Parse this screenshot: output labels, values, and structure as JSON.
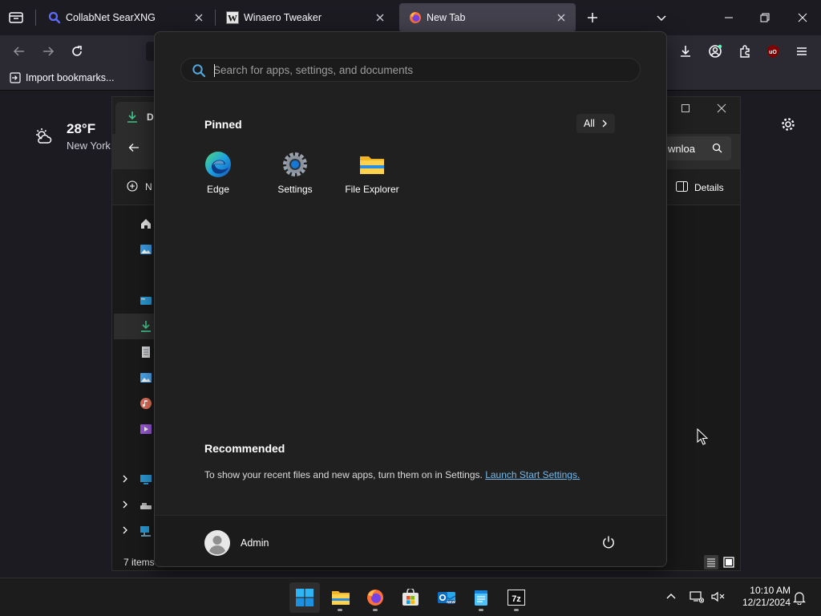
{
  "browser": {
    "tabs": [
      {
        "title": "CollabNet SearXNG"
      },
      {
        "title": "Winaero Tweaker"
      },
      {
        "title": "New Tab"
      }
    ],
    "bookmarks": {
      "import_label": "Import bookmarks..."
    },
    "weather": {
      "temp": "28°F",
      "location": "New York"
    }
  },
  "explorer": {
    "tab_title_partial": "D",
    "search_partial": "wnloa",
    "new_partial": "N",
    "details_label": "Details",
    "status": "7 items"
  },
  "start": {
    "search_placeholder": "Search for apps, settings, and documents",
    "pinned_title": "Pinned",
    "all_label": "All",
    "pinned": [
      {
        "label": "Edge",
        "icon": "edge-icon"
      },
      {
        "label": "Settings",
        "icon": "settings-gear-icon"
      },
      {
        "label": "File Explorer",
        "icon": "file-explorer-icon"
      }
    ],
    "recommended_title": "Recommended",
    "recommended_text": "To show your recent files and new apps, turn them on in Settings.",
    "recommended_link": "Launch Start Settings.",
    "user_name": "Admin"
  },
  "taskbar": {
    "time": "10:10 AM",
    "date": "12/21/2024",
    "apps": [
      "start-icon",
      "file-explorer-icon",
      "firefox-icon",
      "microsoft-store-icon",
      "outlook-icon",
      "notepad-icon",
      "7zip-icon"
    ]
  },
  "colors": {
    "accent": "#4cc2ff",
    "link": "#74b9ea",
    "start_bg": "#202020",
    "taskbar_bg": "#1c1c1c"
  }
}
